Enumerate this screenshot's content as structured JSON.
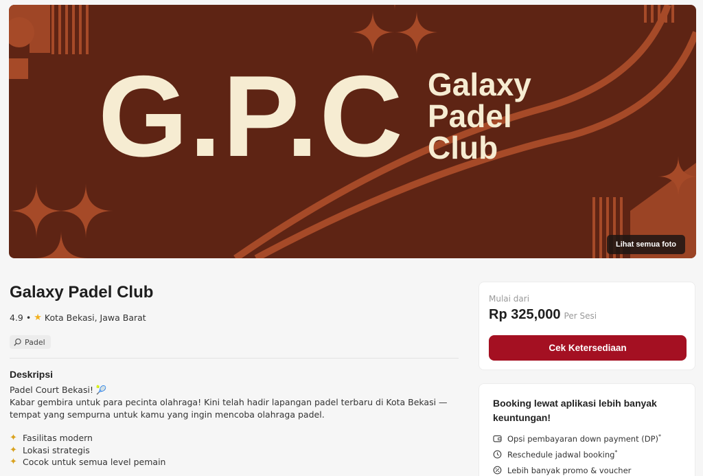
{
  "hero": {
    "logo_text": "G.P.C",
    "logo_sub": [
      "Galaxy",
      "Padel",
      "Club"
    ],
    "photos_button": "Lihat semua foto",
    "colors": {
      "background": "#5e2414",
      "pattern": "#a64a28",
      "logo": "#f6ecd2"
    }
  },
  "venue": {
    "name": "Galaxy Padel Club",
    "rating": "4.9",
    "separator": "•",
    "location": "Kota Bekasi, Jawa Barat",
    "sport_tag": "Padel",
    "sport_icon": "padel-racket-icon"
  },
  "description": {
    "heading": "Deskripsi",
    "headline": "Padel Court Bekasi! 🎾",
    "body": "Kabar gembira untuk para pecinta olahraga! Kini telah hadir lapangan padel terbaru di Kota Bekasi — tempat yang sempurna untuk kamu yang ingin mencoba olahraga padel.",
    "features": [
      "Fasilitas modern",
      "Lokasi strategis",
      "Cocok untuk semua level pemain"
    ],
    "feature_icon": "sparkle-icon"
  },
  "pricing": {
    "label": "Mulai dari",
    "price": "Rp 325,000",
    "unit": "Per Sesi",
    "cta": "Cek Ketersediaan",
    "accent": "#a41022"
  },
  "app_promo": {
    "title": "Booking lewat aplikasi lebih banyak keuntungan!",
    "benefits": [
      {
        "label": "Opsi pembayaran down payment (DP)",
        "note": "*",
        "icon": "wallet-icon"
      },
      {
        "label": "Reschedule jadwal booking",
        "note": "*",
        "icon": "clock-icon"
      },
      {
        "label": "Lebih banyak promo & voucher",
        "note": "",
        "icon": "discount-badge-icon"
      }
    ]
  }
}
